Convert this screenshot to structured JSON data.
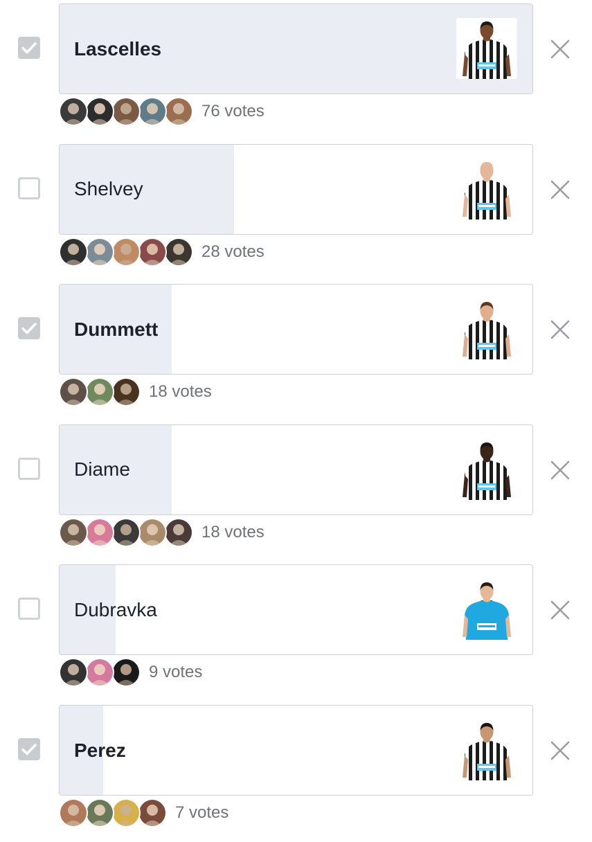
{
  "poll": {
    "max_votes": 76,
    "options": [
      {
        "label": "Lascelles",
        "votes": 76,
        "votes_text": "76 votes",
        "checked": true,
        "kit": "home",
        "skin": "#7a4a2e",
        "hair": "#1b1b1b",
        "photo_bg": "#ffffff",
        "avatars": [
          "#3a3a3a",
          "#2c2c2c",
          "#7b5a45",
          "#5f7c8a",
          "#9a6e4f"
        ]
      },
      {
        "label": "Shelvey",
        "votes": 28,
        "votes_text": "28 votes",
        "checked": false,
        "kit": "home",
        "skin": "#e4b79a",
        "hair": "#e4b79a",
        "photo_bg": "#ffffff",
        "avatars": [
          "#2f2f2f",
          "#7b8c96",
          "#c08a62",
          "#8a4a4a",
          "#3d3530"
        ]
      },
      {
        "label": "Dummett",
        "votes": 18,
        "votes_text": "18 votes",
        "checked": true,
        "kit": "home",
        "skin": "#e0ad8d",
        "hair": "#5a3b22",
        "photo_bg": "#ffffff",
        "avatars": [
          "#5e5048",
          "#6f8a5e",
          "#4a3220"
        ]
      },
      {
        "label": "Diame",
        "votes": 18,
        "votes_text": "18 votes",
        "checked": false,
        "kit": "home",
        "skin": "#3b2418",
        "hair": "#161616",
        "photo_bg": "#ffffff",
        "avatars": [
          "#6b5a4c",
          "#d87a9a",
          "#3a3a3a",
          "#a98a6a",
          "#4a3a38"
        ]
      },
      {
        "label": "Dubravka",
        "votes": 9,
        "votes_text": "9 votes",
        "checked": false,
        "kit": "keeper",
        "skin": "#e5b897",
        "hair": "#2a1d14",
        "photo_bg": "#ffffff",
        "avatars": [
          "#333333",
          "#d47a9e",
          "#1a1a1a"
        ]
      },
      {
        "label": "Perez",
        "votes": 7,
        "votes_text": "7 votes",
        "checked": true,
        "kit": "home",
        "skin": "#c89670",
        "hair": "#1c1410",
        "photo_bg": "#ffffff",
        "avatars": [
          "#b07a5a",
          "#6a7a58",
          "#d8b04a",
          "#7a4a3a"
        ]
      }
    ]
  },
  "colors": {
    "fill": "#eaedf4",
    "check": "#c9cccf",
    "stripe_dark": "#1c1c1c",
    "stripe_light": "#ffffff",
    "keeper": "#20a9e0",
    "sponsor": "#5ac8f0",
    "close": "#9a9ea4"
  },
  "icons": {
    "check": "check-icon",
    "close": "close-icon"
  }
}
